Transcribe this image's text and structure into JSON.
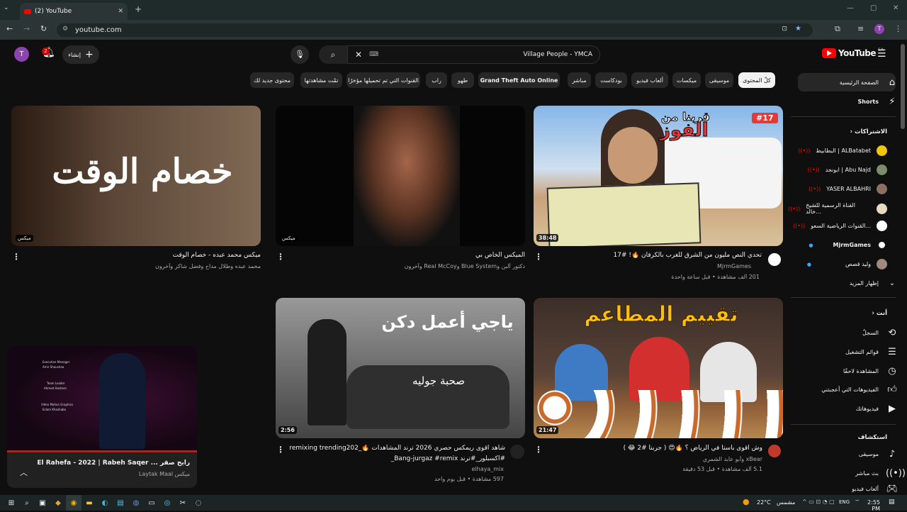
{
  "browser": {
    "tab_title": "(2) YouTube",
    "new_tab": "+",
    "url": "youtube.com",
    "profile_initial": "T"
  },
  "header": {
    "logo_text": "YouTube",
    "region": "SA",
    "search_value": "Village People - YMCA",
    "create_label": "إنشاء",
    "notif_count": "2",
    "avatar_initial": "T"
  },
  "chips": [
    "كلّ المحتوى",
    "موسيقى",
    "ميكسات",
    "ألعاب فيديو",
    "بودكاست",
    "مباشر",
    "Grand Theft Auto Online",
    "طهو",
    "راب",
    "القنوات التي تم تحميلها مؤخرًا",
    "تمّت مشاهدتها",
    "محتوى جديد لك"
  ],
  "videos": [
    {
      "title": "تحدي النص مليون من الشرق للغرب بالكرفان 🔥! #17",
      "channel": "MjrmGames",
      "meta": "201 ألف مشاهدة • قبل ساعة واحدة",
      "duration": "38:48"
    },
    {
      "title": "الميكس الخاص بي",
      "channel": "دكتور ألبن وBlue System وReal McCoy وآخرون",
      "meta": "",
      "duration": "ميكس"
    },
    {
      "title": "ميكس محمد عبده - خصام الوقت",
      "channel": "محمد عبده وطلال مداح وفضل شاكر وآخرون",
      "meta": "",
      "duration": "ميكس"
    },
    {
      "title": "وش اقوى باستا في الرياض ؟ 🔥😍 ( جربنا #2 😂 )",
      "channel": "xBear وأبو عابد الشمري",
      "meta": "5.1 ألف مشاهدة • قبل 53 دقيقة",
      "duration": "21:47"
    },
    {
      "title": "شاهد اقوى ريمكس حصري 2026 ترند المشاهدات 🔥_remixing trending202",
      "channel": "elhaya_mix",
      "meta": "597 مشاهدة • قبل يوم واحد",
      "line2": "#اكسبلور_#ترند Bang-jurgaz #remix_",
      "duration": "2:56"
    }
  ],
  "thumb_text": {
    "v1_top": "قربنا من",
    "v1_big": "الفوز",
    "v1_badge": "#17",
    "v3": "خصام الوقت",
    "v4": "تقييم المطاعم",
    "v5a": "ياجي أعمل دكن",
    "v5b": "صحبة جوليه"
  },
  "miniplayer": {
    "title": "رابح صقر ... El Aabat El Rahefa - 2022 | Rabeh Saqer",
    "channel": "Laytak Maal",
    "label": "ميكس",
    "credits": [
      "Executive Manager",
      "Amir Shoushaa",
      "Team Leader",
      "Ahmed Hashem",
      "Video Motion Graphics",
      "Eslam Khashaba"
    ]
  },
  "sidebar": {
    "home": "الصفحة الرئيسية",
    "shorts": "Shorts",
    "subs_title": "الاشتراكات",
    "subs": [
      {
        "name": "البطابيط | ALBatabet",
        "live": true
      },
      {
        "name": "ابونجد | Abu Najd",
        "live": true
      },
      {
        "name": "YASER ALBAHRI",
        "live": true
      },
      {
        "name": "القناة الرسمية للشيخ خالد...",
        "live": true
      },
      {
        "name": "القنوات الرياضية السعو...",
        "live": true
      },
      {
        "name": "MjrmGames",
        "live": false
      },
      {
        "name": "وليد قصص",
        "live": false
      }
    ],
    "show_more": "إظهار المزيد",
    "you_title": "أنت",
    "you_items": [
      "السجلّ",
      "قوائم التشغيل",
      "المشاهدة لاحقًا",
      "الفيديوهات التي أعجبتني",
      "فيديوهاتك"
    ],
    "explore_title": "استكشاف",
    "explore_items": [
      "موسيقى",
      "بث مباشر",
      "ألعاب فيديو"
    ]
  },
  "taskbar": {
    "weather": "22°C",
    "weather_desc": "مشمس",
    "lang": "ENG",
    "time": "2:55 PM"
  },
  "colors": {
    "bg": "#0f0f0f",
    "accent": "#ff0000",
    "chrome": "#2b3535"
  }
}
